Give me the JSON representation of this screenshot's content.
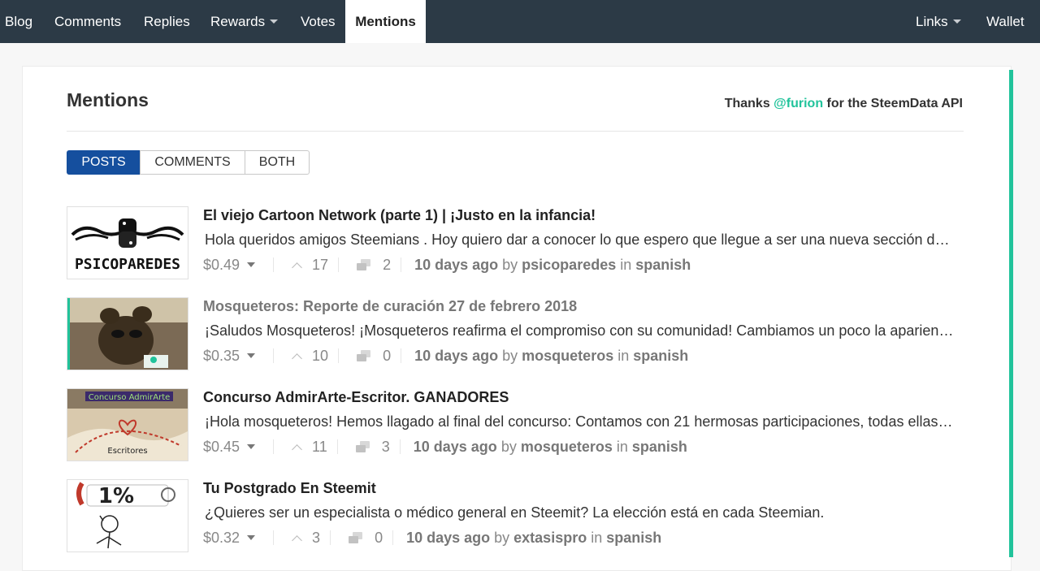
{
  "nav": {
    "items": [
      {
        "label": "Blog"
      },
      {
        "label": "Comments"
      },
      {
        "label": "Replies"
      },
      {
        "label": "Rewards"
      },
      {
        "label": "Votes"
      },
      {
        "label": "Mentions"
      }
    ],
    "right": [
      {
        "label": "Links"
      },
      {
        "label": "Wallet"
      }
    ],
    "active": "Mentions"
  },
  "page": {
    "title": "Mentions",
    "thanks_prefix": "Thanks",
    "thanks_handle": "@furion",
    "thanks_suffix": "for the SteemData API"
  },
  "tabs": [
    {
      "label": "POSTS",
      "active": true
    },
    {
      "label": "COMMENTS",
      "active": false
    },
    {
      "label": "BOTH",
      "active": false
    }
  ],
  "posts": [
    {
      "title": "El viejo Cartoon Network (parte 1) | ¡Justo en la infancia!",
      "excerpt": "Hola queridos amigos Steemians . Hoy quiero dar a conocer lo que espero que llegue a ser una nueva sección de mi blog",
      "payout": "$0.49",
      "votes": "17",
      "comments": "2",
      "age": "10 days ago",
      "by": "by",
      "author": "psicoparedes",
      "in": "in",
      "category": "spanish",
      "thumb_text": "PSICOPAREDES"
    },
    {
      "title": "Mosqueteros: Reporte de curación 27 de febrero 2018",
      "excerpt": "¡Saludos Mosqueteros! ¡Mosqueteros reafirma el compromiso con su comunidad! Cambiamos un poco la apariencia del reporte",
      "payout": "$0.35",
      "votes": "10",
      "comments": "0",
      "age": "10 days ago",
      "by": "by",
      "author": "mosqueteros",
      "in": "in",
      "category": "spanish"
    },
    {
      "title": "Concurso AdmirArte-Escritor. GANADORES",
      "excerpt": "¡Hola mosqueteros! Hemos llagado al final del concurso: Contamos con 21 hermosas participaciones, todas ellas maravillosas",
      "payout": "$0.45",
      "votes": "11",
      "comments": "3",
      "age": "10 days ago",
      "by": "by",
      "author": "mosqueteros",
      "in": "in",
      "category": "spanish",
      "thumb_top": "Concurso AdmirArte",
      "thumb_bottom": "Escritores"
    },
    {
      "title": "Tu Postgrado En Steemit",
      "excerpt": "¿Quieres ser un especialista o médico general en Steemit? La elección está en cada Steemian.",
      "payout": "$0.32",
      "votes": "3",
      "comments": "0",
      "age": "10 days ago",
      "by": "by",
      "author": "extasispro",
      "in": "in",
      "category": "spanish",
      "thumb_text": "1%"
    }
  ],
  "colors": {
    "nav_bg": "#2c3a46",
    "accent": "#21c39b",
    "tab_active": "#154f9e"
  }
}
